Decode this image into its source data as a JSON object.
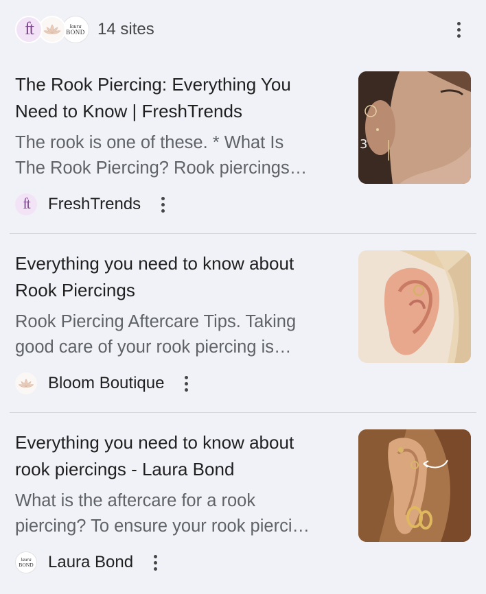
{
  "header": {
    "sites_count": "14 sites",
    "favicons": [
      "ft",
      "lotus-icon",
      "laura-bond-logo"
    ]
  },
  "results": [
    {
      "title_lines": [
        "The Rook Piercing: Everything You",
        "Need to Know | FreshTrends"
      ],
      "snippet_lines": [
        "The rook is one of these. * What Is",
        "The Rook Piercing? Rook piercings…"
      ],
      "source": "FreshTrends",
      "source_icon": "ft",
      "thumbnail": "woman-face-ear-piercing-photo"
    },
    {
      "title_lines": [
        "Everything you need to know about",
        "Rook Piercings"
      ],
      "snippet_lines": [
        "Rook Piercing Aftercare Tips. Taking",
        "good care of your rook piercing is…"
      ],
      "source": "Bloom Boutique",
      "source_icon": "lotus-icon",
      "thumbnail": "ear-rook-ring-photo"
    },
    {
      "title_lines": [
        "Everything you need to know about",
        "rook piercings - Laura Bond"
      ],
      "snippet_lines": [
        "What is the aftercare for a rook",
        "piercing? To ensure your rook pierci…"
      ],
      "source": "Laura Bond",
      "source_icon": "laura-bond-logo",
      "thumbnail": "ear-gold-hoops-photo"
    }
  ],
  "logo_text": {
    "laura_bond_small": "laura",
    "laura_bond_big": "BOND"
  },
  "colors": {
    "background": "#f0f2f7",
    "title": "#1f1f1f",
    "snippet": "#5f6368",
    "divider": "#d3d5da",
    "ft_brand": "#7e4b8e"
  }
}
